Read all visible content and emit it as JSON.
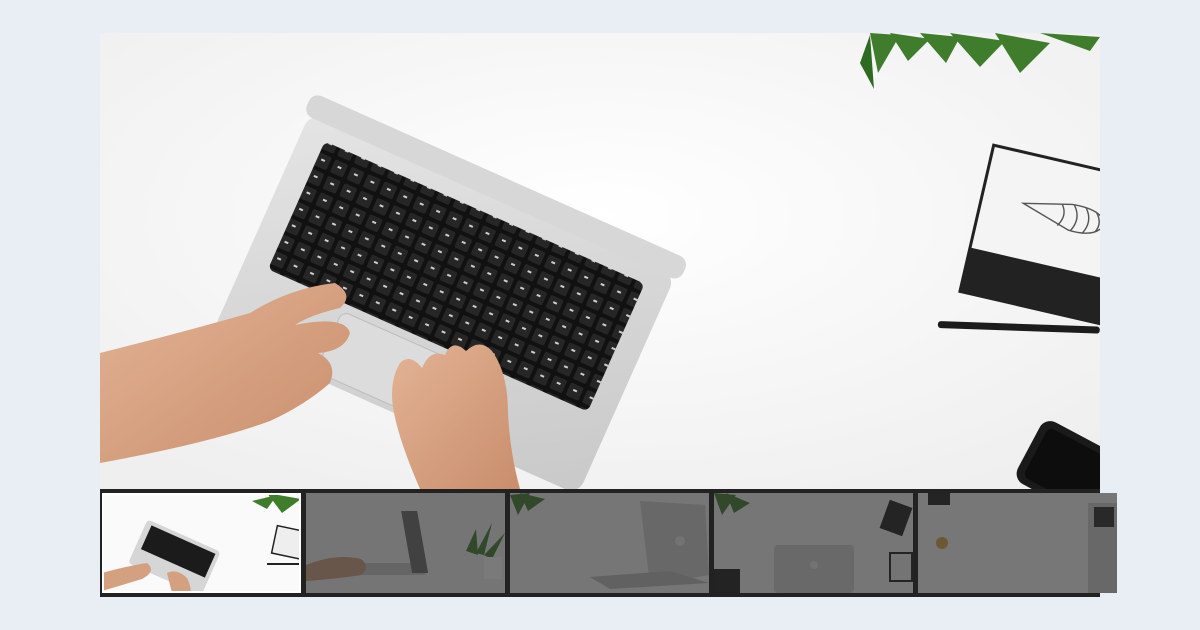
{
  "gallery": {
    "active_index": 0,
    "main_image": {
      "subject": "laptop-typing-desk",
      "alt": ""
    },
    "thumbnails": [
      {
        "subject": "laptop-typing-desk"
      },
      {
        "subject": "laptop-hands-plant"
      },
      {
        "subject": "laptop-side-view"
      },
      {
        "subject": "desk-top-view-objects"
      },
      {
        "subject": "desk-corner-laptop"
      }
    ]
  },
  "colors": {
    "page_background": "#e8eef4",
    "strip_background": "#222222",
    "desk_surface": "#fafafa",
    "keyboard_keys": "#1b1b1b",
    "plant_green": "#3f7d2d"
  }
}
